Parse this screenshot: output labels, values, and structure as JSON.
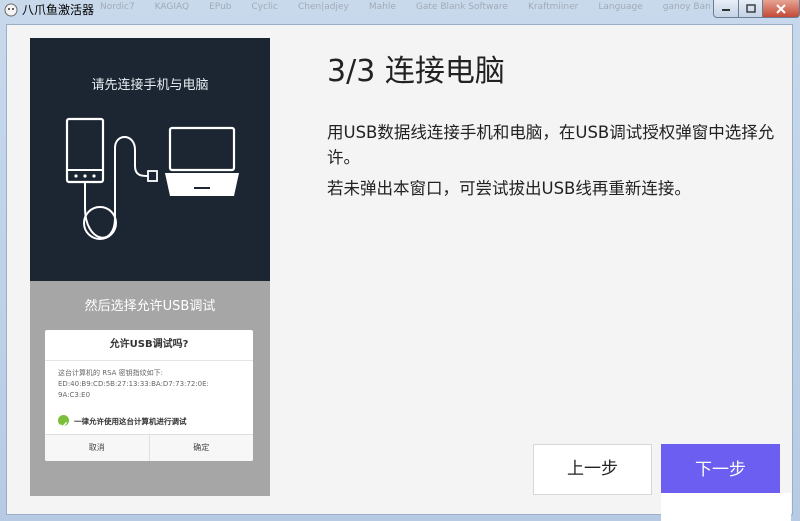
{
  "window": {
    "title": "八爪鱼激活器",
    "bg_tabs": [
      "Nordic7",
      "KAGIAQ",
      "EPub",
      "Cyclic",
      "Chen|adjey",
      "Mahle",
      "Gate Blank Software",
      "Kraftmiiner",
      "Language",
      "ganoy Bang Timepoint"
    ]
  },
  "illustration": {
    "connect_prompt": "请先连接手机与电脑",
    "select_prompt": "然后选择允许USB调试",
    "dialog": {
      "title": "允许USB调试吗?",
      "body_line1": "这台计算机的 RSA 密钥指纹如下:",
      "body_line2": "ED:40:B9:CD:5B:27:13:33:BA:D7:73:72:0E:",
      "body_line3": "9A:C3:E0",
      "always_allow": "一律允许使用这台计算机进行调试",
      "cancel": "取消",
      "ok": "确定"
    }
  },
  "main": {
    "step_title": "3/3 连接电脑",
    "instruction_1": "用USB数据线连接手机和电脑，在USB调试授权弹窗中选择允许。",
    "instruction_2": "若未弹出本窗口，可尝试拔出USB线再重新连接。"
  },
  "buttons": {
    "prev": "上一步",
    "next": "下一步"
  },
  "colors": {
    "accent": "#6b5ef0",
    "panel_dark": "#1c2632",
    "check_green": "#7dbe3b"
  }
}
